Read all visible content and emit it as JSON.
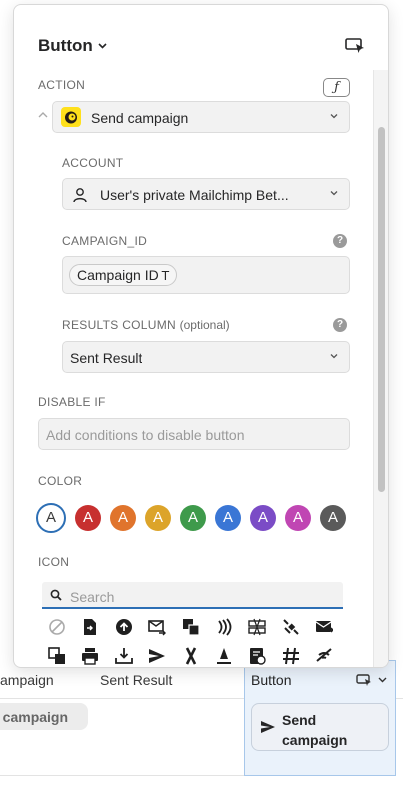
{
  "background": {
    "col_campaign_header": "ampaign",
    "col_sent_result_header": "Sent Result",
    "col_button_header": "Button",
    "row_campaign_pill": "e campaign",
    "send_button_label": "Send campaign"
  },
  "panel": {
    "title": "Button",
    "action": {
      "label": "ACTION",
      "fx_label": "ƒ",
      "selected": "Send campaign"
    },
    "account": {
      "label": "ACCOUNT",
      "value": "User's private Mailchimp Bet..."
    },
    "campaign_id": {
      "label": "CAMPAIGN_ID",
      "chip": "Campaign ID",
      "chip_type": "T"
    },
    "results_column": {
      "label": "RESULTS COLUMN",
      "optional": "(optional)",
      "value": "Sent Result"
    },
    "disable_if": {
      "label": "DISABLE IF",
      "placeholder": "Add conditions to disable button"
    },
    "color": {
      "label": "COLOR",
      "swatches": [
        {
          "letter": "A",
          "hex": "#ffffff",
          "selected": true
        },
        {
          "letter": "A",
          "hex": "#c7302f"
        },
        {
          "letter": "A",
          "hex": "#e0742c"
        },
        {
          "letter": "A",
          "hex": "#dca42a"
        },
        {
          "letter": "A",
          "hex": "#3e9a4b"
        },
        {
          "letter": "A",
          "hex": "#3a76d5"
        },
        {
          "letter": "A",
          "hex": "#7b4cc6"
        },
        {
          "letter": "A",
          "hex": "#c046b3"
        },
        {
          "letter": "A",
          "hex": "#5a5a5a"
        }
      ]
    },
    "icon": {
      "label": "ICON",
      "search_placeholder": "Search",
      "icons": [
        "none-icon",
        "file-arrow-icon",
        "upload-circle-icon",
        "mail-arrow-icon",
        "copy-icon",
        "nfc-icon",
        "dns-icon",
        "satellite-icon",
        "mail-send-icon",
        "duplicate-icon",
        "print-icon",
        "download-tray-icon",
        "send-icon",
        "ribbon-icon",
        "rule-icon",
        "receipt-icon",
        "hashtag-icon",
        "no-signal-icon"
      ]
    }
  }
}
